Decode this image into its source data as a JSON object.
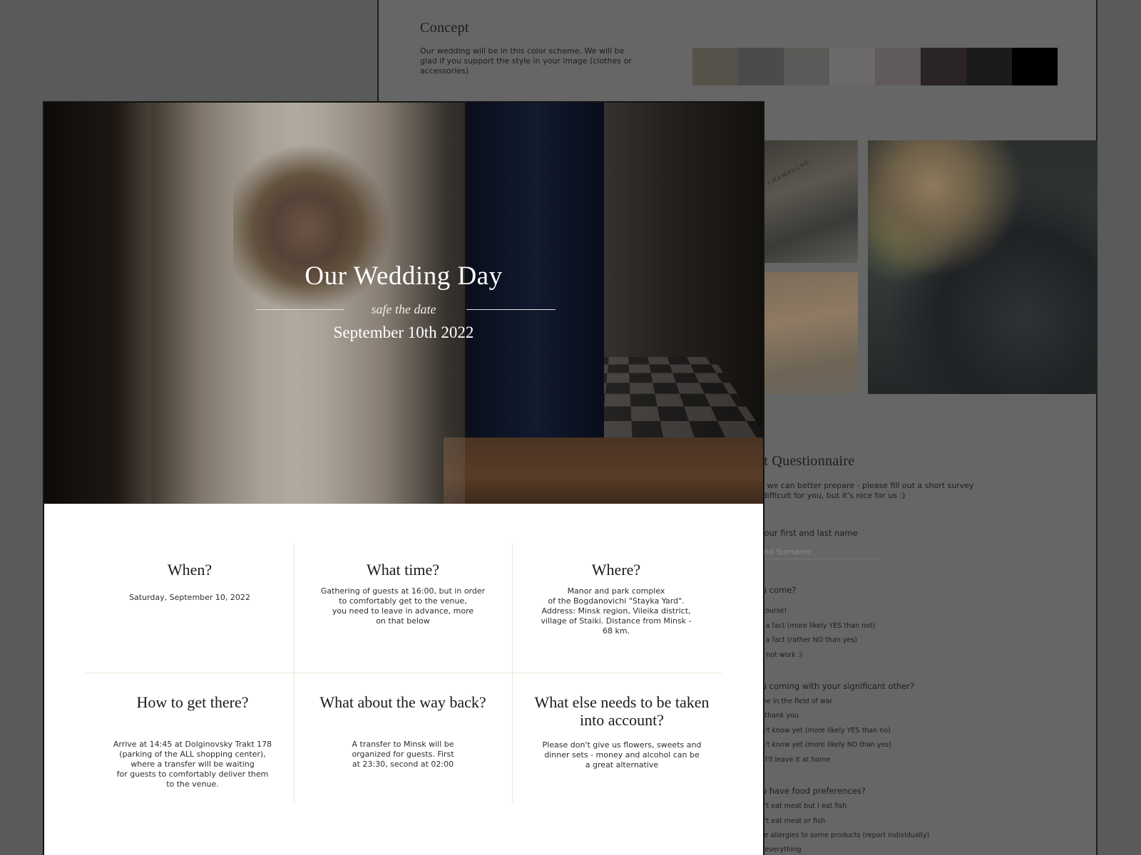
{
  "concept": {
    "title": "Concept",
    "text": "Our wedding will be in this color scheme. We will be glad if you support the style in your image (clothes or accessories)",
    "swatches": [
      "#575249",
      "#494b4c",
      "#5a5a58",
      "#6c6a69",
      "#615a5b",
      "#2a2424",
      "#1c1b1b",
      "#000000"
    ]
  },
  "photo_label": "CHAMPAGNE",
  "questionnaire": {
    "title": "est Questionnaire",
    "intro": "hat we can better prepare - please fill out a short survey\not difficult for you, but it's nice for us :)",
    "name_label": "e your first and last name",
    "name_placeholder": "e and Surname",
    "q1": {
      "label": "you come?",
      "options": [
        "Of course!",
        "Not a fact (more likely YES than not)",
        "Not a fact (rather NO than yes)",
        "Will not work :("
      ]
    },
    "q2": {
      "label": "you coming with your significant other?",
      "options": [
        "Alone in the field of war",
        "Yes thank you",
        "Don't know yet (more likely YES than no)",
        "Don't know yet (more likely NO than yes)",
        "No, I'll leave it at home"
      ]
    },
    "q3": {
      "label": "you have food preferences?",
      "options": [
        "don't eat meat but I eat fish",
        "don't eat meat or fish",
        "have allergies to some products (report individually)",
        "eat everything"
      ]
    }
  },
  "hero": {
    "title": "Our Wedding Day",
    "subtitle": "safe the date",
    "date": "September 10th 2022"
  },
  "info": [
    {
      "title": "When?",
      "text": "Saturday, September 10, 2022"
    },
    {
      "title": "What time?",
      "text": "Gathering of guests at 16:00, but in order\nto comfortably get to the venue,\nyou need to leave in advance, more\non that below"
    },
    {
      "title": "Where?",
      "text": "Manor and park complex\nof the Bogdanovichi \"Stayka Yard\".\nAddress: Minsk region, Vileika district,\nvillage of Staiki. Distance from Minsk -\n68 km."
    },
    {
      "title": "How to get there?",
      "text": "Arrive at 14:45 at Dolginovsky Trakt 178\n(parking of the ALL shopping center),\nwhere a transfer will be waiting\nfor guests to comfortably deliver them\nto the venue."
    },
    {
      "title": "What about the way back?",
      "text": "A transfer to Minsk will be\norganized for guests. First\nat 23:30, second at 02:00"
    },
    {
      "title": "What else needs to be taken into account?",
      "text": "Please don't give us flowers, sweets and\ndinner sets - money and alcohol can be\na great alternative"
    }
  ]
}
